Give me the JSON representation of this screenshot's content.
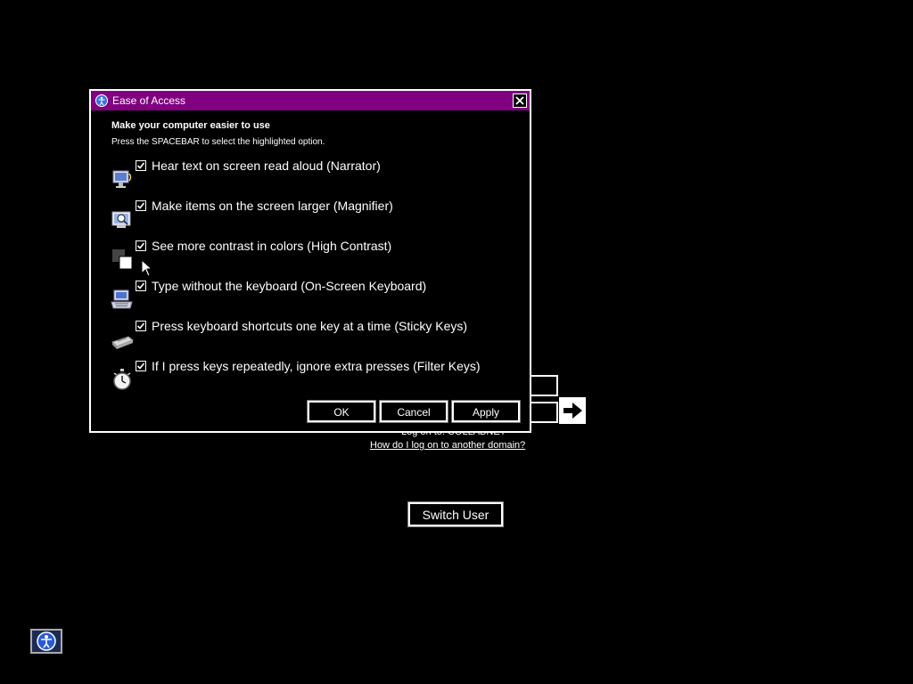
{
  "login": {
    "logon_to": "Log on to: COLLABNET",
    "domain_link": "How do I log on to another domain?",
    "switch_user": "Switch User",
    "ease_of_access_icon": "ease-of-access-icon",
    "submit_icon": "arrow-right-icon"
  },
  "dialog": {
    "title": "Ease of Access",
    "heading": "Make your computer easier to use",
    "subtext": "Press the SPACEBAR to select the highlighted option.",
    "options": [
      {
        "label": "Hear text on screen read aloud (Narrator)",
        "checked": true,
        "icon": "narrator-icon"
      },
      {
        "label": "Make items on the screen larger (Magnifier)",
        "checked": true,
        "icon": "magnifier-icon"
      },
      {
        "label": "See more contrast in colors (High Contrast)",
        "checked": true,
        "icon": "high-contrast-icon"
      },
      {
        "label": "Type without the keyboard (On-Screen Keyboard)",
        "checked": true,
        "icon": "on-screen-keyboard-icon"
      },
      {
        "label": "Press keyboard shortcuts one key at a time (Sticky Keys)",
        "checked": true,
        "icon": "sticky-keys-icon"
      },
      {
        "label": "If I press keys repeatedly, ignore extra presses (Filter Keys)",
        "checked": true,
        "icon": "filter-keys-icon"
      }
    ],
    "buttons": {
      "ok": "OK",
      "cancel": "Cancel",
      "apply": "Apply"
    }
  },
  "colors": {
    "titlebar": "#800080",
    "background": "#000000",
    "text": "#ffffff"
  }
}
